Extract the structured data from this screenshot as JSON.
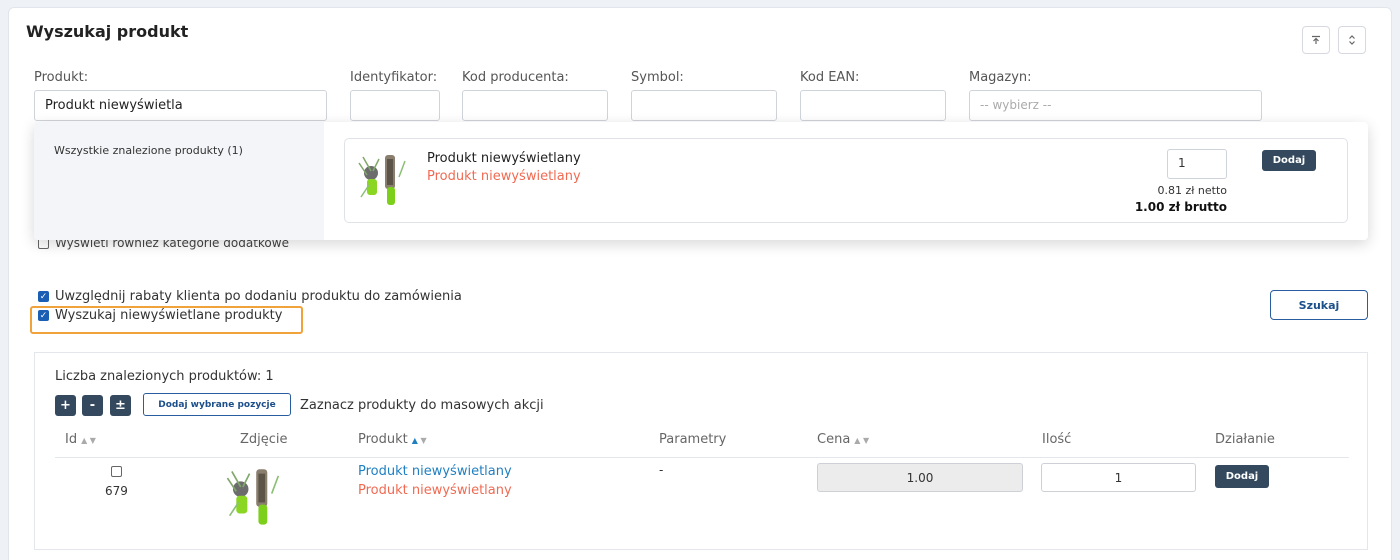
{
  "header": {
    "title": "Wyszukaj produkt"
  },
  "filters": {
    "produkt_label": "Produkt:",
    "produkt_value": "Produkt niewyświetla",
    "identyfikator_label": "Identyfikator:",
    "kod_producenta_label": "Kod producenta:",
    "symbol_label": "Symbol:",
    "kod_ean_label": "Kod EAN:",
    "magazyn_label": "Magazyn:",
    "magazyn_placeholder": "-- wybierz --"
  },
  "dropdown": {
    "all_found": "Wszystkie znalezione produkty (1)",
    "item": {
      "name": "Produkt niewyświetlany",
      "subname": "Produkt niewyświetlany",
      "qty": "1",
      "add_label": "Dodaj",
      "net": "0.81 zł netto",
      "gross": "1.00 zł brutto"
    }
  },
  "options": {
    "extra_categories": "Wyświetl również kategorie dodatkowe",
    "client_discounts": "Uwzględnij rabaty klienta po dodaniu produktu do zamówienia",
    "search_hidden": "Wyszukaj niewyświetlane produkty",
    "search_button": "Szukaj"
  },
  "results": {
    "count_label": "Liczba znalezionych produktów: 1",
    "plus": "+",
    "minus": "-",
    "plusminus": "±",
    "add_selected": "Dodaj wybrane pozycje",
    "mass_actions": "Zaznacz produkty do masowych akcji",
    "columns": {
      "id": "Id",
      "photo": "Zdjęcie",
      "product": "Produkt",
      "params": "Parametry",
      "price": "Cena",
      "qty": "Ilość",
      "action": "Działanie"
    },
    "rows": [
      {
        "id": "679",
        "name": "Produkt niewyświetlany",
        "subname": "Produkt niewyświetlany",
        "params": "-",
        "price": "1.00",
        "qty": "1",
        "action": "Dodaj"
      }
    ]
  },
  "colors": {
    "accent_dark": "#34495e",
    "link_blue": "#1f7fc1",
    "product_red": "#f06a52",
    "highlight_orange": "#f0a23b",
    "checkbox_blue": "#1a5fb4"
  }
}
